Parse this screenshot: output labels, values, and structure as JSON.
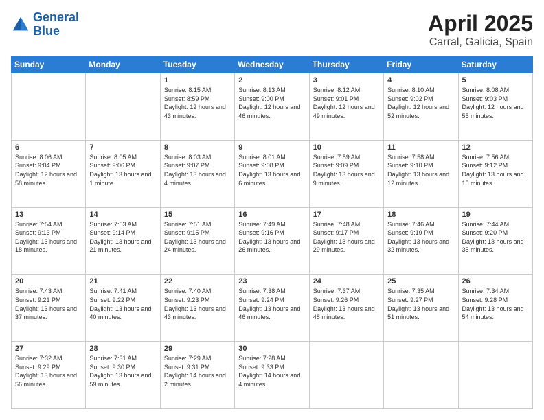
{
  "header": {
    "logo_line1": "General",
    "logo_line2": "Blue",
    "title": "April 2025",
    "subtitle": "Carral, Galicia, Spain"
  },
  "columns": [
    "Sunday",
    "Monday",
    "Tuesday",
    "Wednesday",
    "Thursday",
    "Friday",
    "Saturday"
  ],
  "weeks": [
    [
      {
        "day": "",
        "info": ""
      },
      {
        "day": "",
        "info": ""
      },
      {
        "day": "1",
        "info": "Sunrise: 8:15 AM\nSunset: 8:59 PM\nDaylight: 12 hours and 43 minutes."
      },
      {
        "day": "2",
        "info": "Sunrise: 8:13 AM\nSunset: 9:00 PM\nDaylight: 12 hours and 46 minutes."
      },
      {
        "day": "3",
        "info": "Sunrise: 8:12 AM\nSunset: 9:01 PM\nDaylight: 12 hours and 49 minutes."
      },
      {
        "day": "4",
        "info": "Sunrise: 8:10 AM\nSunset: 9:02 PM\nDaylight: 12 hours and 52 minutes."
      },
      {
        "day": "5",
        "info": "Sunrise: 8:08 AM\nSunset: 9:03 PM\nDaylight: 12 hours and 55 minutes."
      }
    ],
    [
      {
        "day": "6",
        "info": "Sunrise: 8:06 AM\nSunset: 9:04 PM\nDaylight: 12 hours and 58 minutes."
      },
      {
        "day": "7",
        "info": "Sunrise: 8:05 AM\nSunset: 9:06 PM\nDaylight: 13 hours and 1 minute."
      },
      {
        "day": "8",
        "info": "Sunrise: 8:03 AM\nSunset: 9:07 PM\nDaylight: 13 hours and 4 minutes."
      },
      {
        "day": "9",
        "info": "Sunrise: 8:01 AM\nSunset: 9:08 PM\nDaylight: 13 hours and 6 minutes."
      },
      {
        "day": "10",
        "info": "Sunrise: 7:59 AM\nSunset: 9:09 PM\nDaylight: 13 hours and 9 minutes."
      },
      {
        "day": "11",
        "info": "Sunrise: 7:58 AM\nSunset: 9:10 PM\nDaylight: 13 hours and 12 minutes."
      },
      {
        "day": "12",
        "info": "Sunrise: 7:56 AM\nSunset: 9:12 PM\nDaylight: 13 hours and 15 minutes."
      }
    ],
    [
      {
        "day": "13",
        "info": "Sunrise: 7:54 AM\nSunset: 9:13 PM\nDaylight: 13 hours and 18 minutes."
      },
      {
        "day": "14",
        "info": "Sunrise: 7:53 AM\nSunset: 9:14 PM\nDaylight: 13 hours and 21 minutes."
      },
      {
        "day": "15",
        "info": "Sunrise: 7:51 AM\nSunset: 9:15 PM\nDaylight: 13 hours and 24 minutes."
      },
      {
        "day": "16",
        "info": "Sunrise: 7:49 AM\nSunset: 9:16 PM\nDaylight: 13 hours and 26 minutes."
      },
      {
        "day": "17",
        "info": "Sunrise: 7:48 AM\nSunset: 9:17 PM\nDaylight: 13 hours and 29 minutes."
      },
      {
        "day": "18",
        "info": "Sunrise: 7:46 AM\nSunset: 9:19 PM\nDaylight: 13 hours and 32 minutes."
      },
      {
        "day": "19",
        "info": "Sunrise: 7:44 AM\nSunset: 9:20 PM\nDaylight: 13 hours and 35 minutes."
      }
    ],
    [
      {
        "day": "20",
        "info": "Sunrise: 7:43 AM\nSunset: 9:21 PM\nDaylight: 13 hours and 37 minutes."
      },
      {
        "day": "21",
        "info": "Sunrise: 7:41 AM\nSunset: 9:22 PM\nDaylight: 13 hours and 40 minutes."
      },
      {
        "day": "22",
        "info": "Sunrise: 7:40 AM\nSunset: 9:23 PM\nDaylight: 13 hours and 43 minutes."
      },
      {
        "day": "23",
        "info": "Sunrise: 7:38 AM\nSunset: 9:24 PM\nDaylight: 13 hours and 46 minutes."
      },
      {
        "day": "24",
        "info": "Sunrise: 7:37 AM\nSunset: 9:26 PM\nDaylight: 13 hours and 48 minutes."
      },
      {
        "day": "25",
        "info": "Sunrise: 7:35 AM\nSunset: 9:27 PM\nDaylight: 13 hours and 51 minutes."
      },
      {
        "day": "26",
        "info": "Sunrise: 7:34 AM\nSunset: 9:28 PM\nDaylight: 13 hours and 54 minutes."
      }
    ],
    [
      {
        "day": "27",
        "info": "Sunrise: 7:32 AM\nSunset: 9:29 PM\nDaylight: 13 hours and 56 minutes."
      },
      {
        "day": "28",
        "info": "Sunrise: 7:31 AM\nSunset: 9:30 PM\nDaylight: 13 hours and 59 minutes."
      },
      {
        "day": "29",
        "info": "Sunrise: 7:29 AM\nSunset: 9:31 PM\nDaylight: 14 hours and 2 minutes."
      },
      {
        "day": "30",
        "info": "Sunrise: 7:28 AM\nSunset: 9:33 PM\nDaylight: 14 hours and 4 minutes."
      },
      {
        "day": "",
        "info": ""
      },
      {
        "day": "",
        "info": ""
      },
      {
        "day": "",
        "info": ""
      }
    ]
  ]
}
